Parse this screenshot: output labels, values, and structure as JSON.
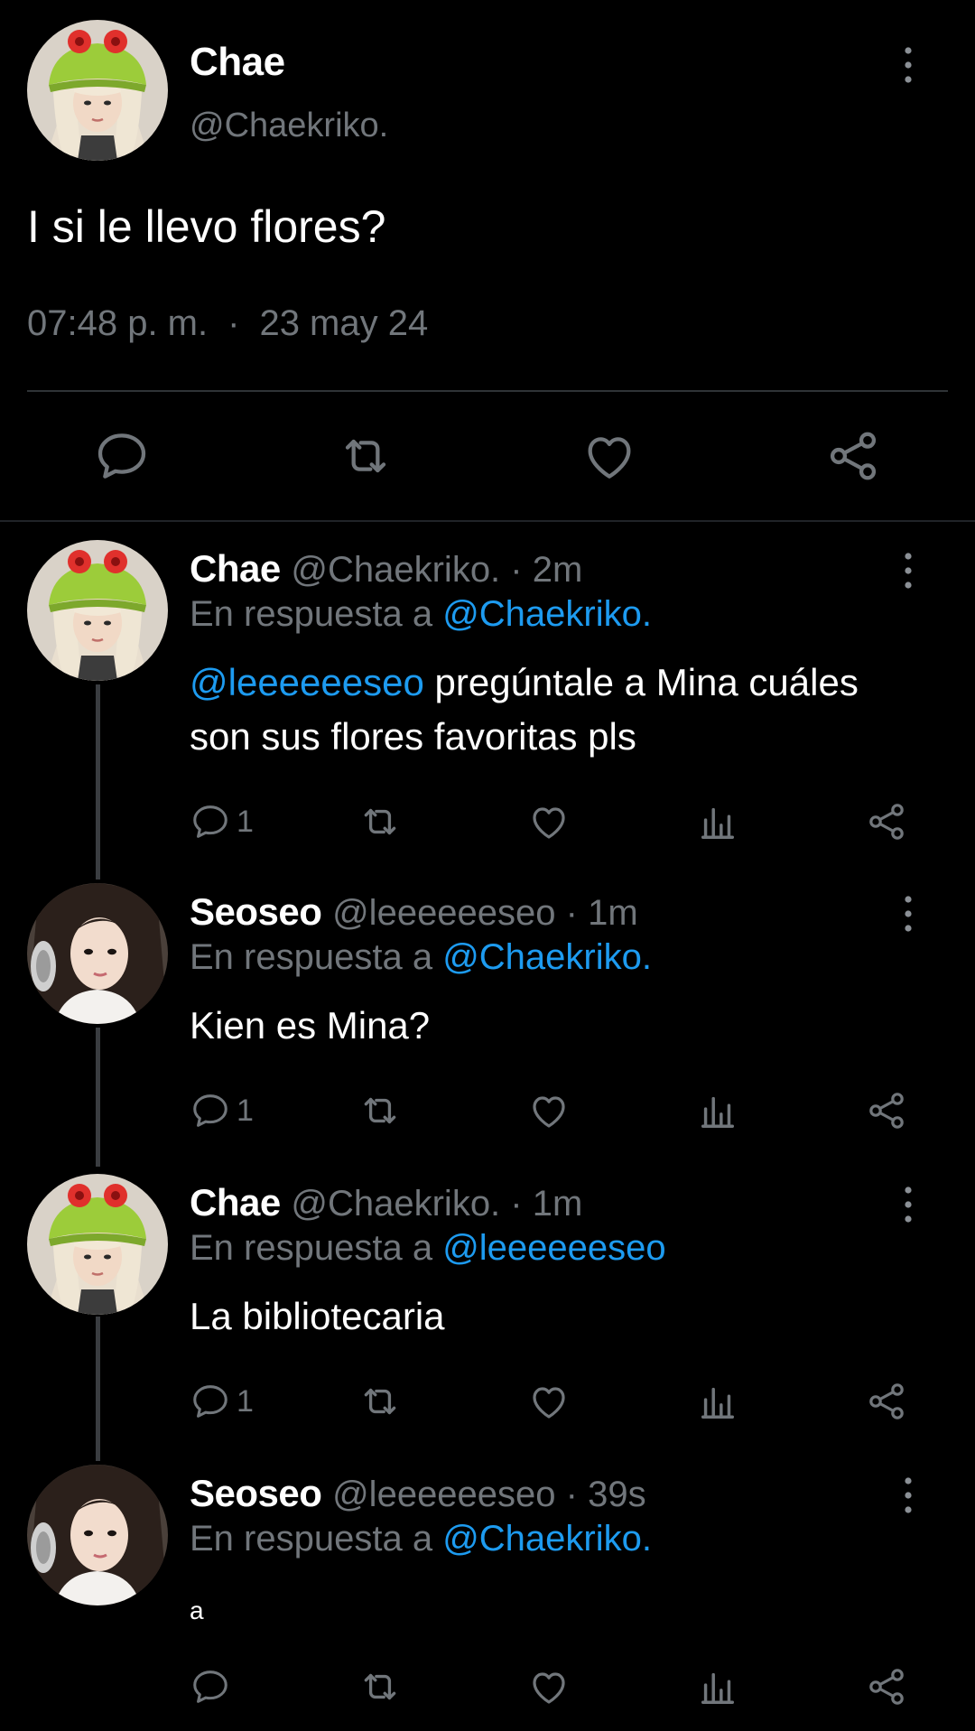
{
  "main_tweet": {
    "name": "Chae",
    "handle": "@Chaekriko.",
    "text": "I si le llevo flores?",
    "time": "07:48 p. m.",
    "separator": "·",
    "date": "23 may 24"
  },
  "replies": [
    {
      "name": "Chae",
      "meta": "@Chaekriko. · 2m",
      "in_reply_prefix": "En respuesta a",
      "in_reply_to": "@Chaekriko.",
      "mention": "@leeeeeeseo",
      "text": " pregúntale a Mina cuáles son sus flores favoritas pls",
      "reply_count": "1"
    },
    {
      "name": "Seoseo",
      "meta": "@leeeeeeseo · 1m",
      "in_reply_prefix": "En respuesta a",
      "in_reply_to": "@Chaekriko.",
      "text": "Kien es Mina?",
      "reply_count": "1"
    },
    {
      "name": "Chae",
      "meta": "@Chaekriko. · 1m",
      "in_reply_prefix": "En respuesta a",
      "in_reply_to": "@leeeeeeseo",
      "text": "La bibliotecaria",
      "reply_count": "1"
    },
    {
      "name": "Seoseo",
      "meta": "@leeeeeeseo · 39s",
      "in_reply_prefix": "En respuesta a",
      "in_reply_to": "@Chaekriko.",
      "text": "a",
      "reply_count": ""
    }
  ],
  "icons": [
    "more-vertical-icon",
    "reply-icon",
    "retweet-icon",
    "like-icon",
    "views-icon",
    "share-icon"
  ],
  "colors": {
    "background": "#000000",
    "muted": "#71767b",
    "link": "#1d9bf0",
    "divider": "#2f3336"
  }
}
